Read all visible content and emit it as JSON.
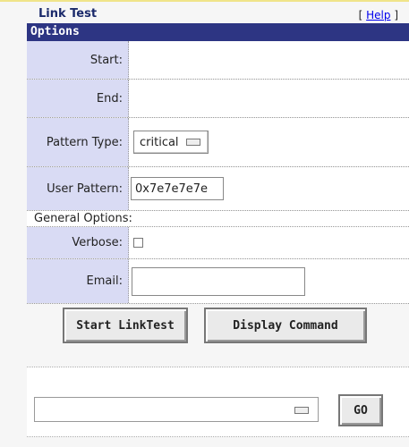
{
  "header": {
    "title": "Link Test",
    "help_open": "[",
    "help_link": "Help",
    "help_close": "]"
  },
  "options": {
    "section_title": "Options",
    "start_label": "Start:",
    "start_value": "",
    "end_label": "End:",
    "end_value": "",
    "pattern_type_label": "Pattern Type:",
    "pattern_type_value": "critical",
    "user_pattern_label": "User Pattern:",
    "user_pattern_value": "0x7e7e7e7e",
    "general_options_label": "General Options:",
    "verbose_label": "Verbose:",
    "verbose_checked": false,
    "email_label": "Email:",
    "email_value": ""
  },
  "actions": {
    "start_label": "Start LinkTest",
    "display_label": "Display Command"
  },
  "bottom": {
    "select_value": "",
    "go_label": "GO"
  }
}
